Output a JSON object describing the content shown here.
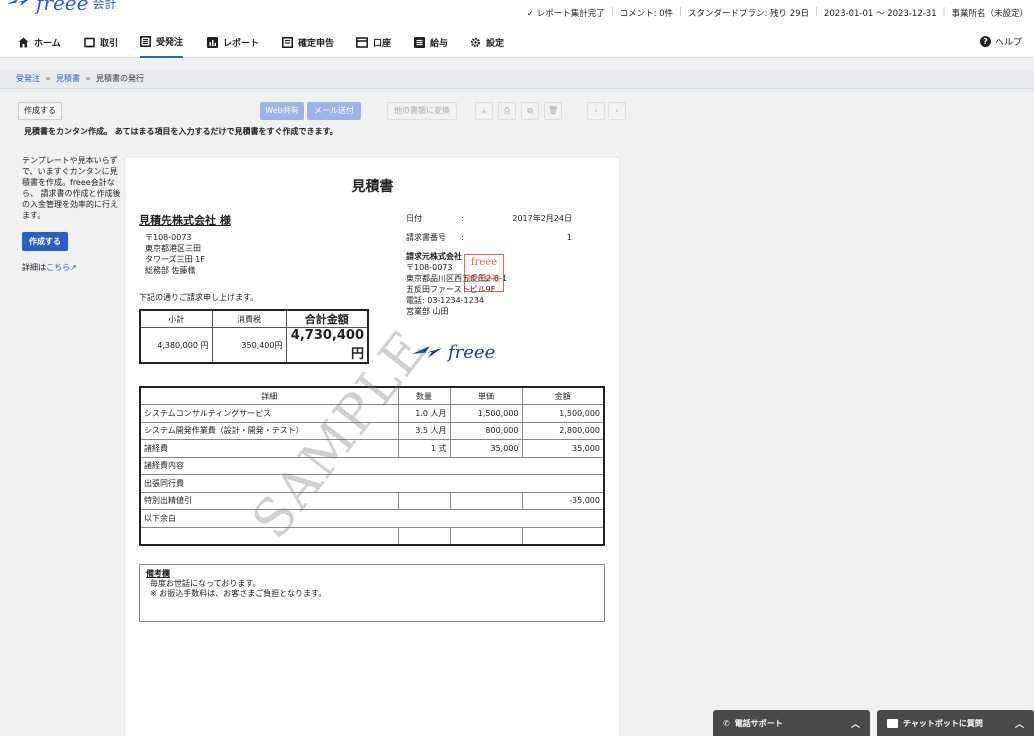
{
  "app": {
    "logo": "freee",
    "logo_sub": "会計"
  },
  "status_bar": {
    "report": "✓ レポート集計完了",
    "comment": "コメント: 0件",
    "plan": "スタンダードプラン: 残り 29日",
    "period": "2023-01-01 〜 2023-12-31",
    "office": "事業所名（未設定）"
  },
  "nav": {
    "items": [
      {
        "label": "ホーム",
        "icon": "home-icon"
      },
      {
        "label": "取引",
        "icon": "transaction-icon"
      },
      {
        "label": "受発注",
        "icon": "order-icon"
      },
      {
        "label": "レポート",
        "icon": "report-icon"
      },
      {
        "label": "確定申告",
        "icon": "tax-return-icon"
      },
      {
        "label": "口座",
        "icon": "account-icon"
      },
      {
        "label": "給与",
        "icon": "payroll-icon"
      },
      {
        "label": "設定",
        "icon": "gear-icon"
      }
    ],
    "active": "受発注",
    "help": "ヘルプ"
  },
  "breadcrumb": {
    "items": [
      "受発注",
      "見積書",
      "見積書の発行"
    ],
    "sep": "»"
  },
  "toolbar": {
    "create": "作成する",
    "web_share": "Web共有",
    "mail_send": "メール送付",
    "convert": "他の書類に変換",
    "download_icon": "⤓",
    "print_icon": "⎙",
    "copy_icon": "⧉",
    "delete_icon": "🗑",
    "prev": "‹",
    "next": "›",
    "description": "見積書をカンタン作成。 あてはまる項目を入力するだけで見積書をすぐ作成できます。"
  },
  "sidebar": {
    "text": "テンプレートや見本いらずで、いますぐカンタンに見積書を作成。freee会計なら、 請求書の作成と作成後の入金管理を効率的に行えます。",
    "create": "作成する",
    "more_prefix": "詳細は",
    "more_link": "こちら"
  },
  "document": {
    "title": "見積書",
    "recipient": "見積先株式会社 様",
    "recipient_address": [
      "〒108-0073",
      "東京都港区三田",
      "タワーズ三田 1F",
      "総務部 佐藤様"
    ],
    "lead": "下記の通りご請求申し上げます。",
    "summary": {
      "headers": [
        "小計",
        "消費税",
        "合計金額"
      ],
      "values": [
        "4,380,000 円",
        "350,400円",
        "4,730,400円"
      ]
    },
    "meta": [
      {
        "key": "日付",
        "value": "2017年2月24日"
      },
      {
        "key": "請求書番号",
        "value": "1"
      }
    ],
    "issuer": {
      "name": "請求元株式会社",
      "lines": [
        "〒108-0073",
        "東京都品川区西五反田2-8-1",
        "五反田ファーストビル9F",
        "電話: 03-1234-1234",
        "営業部 山田"
      ]
    },
    "stamp": [
      "freee",
      "株式会社"
    ],
    "signature": "freee",
    "detail": {
      "headers": [
        "詳細",
        "数量",
        "単価",
        "金額"
      ],
      "rows": [
        [
          "システムコンサルティングサービス",
          "1.0 人月",
          "1,500,000",
          "1,500,000"
        ],
        [
          "システム開発作業費（設計・開発・テスト）",
          "3.5 人月",
          "800,000",
          "2,800,000"
        ],
        [
          "諸経費",
          "1 式",
          "35,000",
          "35,000"
        ],
        [
          "諸経費内容",
          "",
          "",
          ""
        ],
        [
          "出張同行費",
          "",
          "",
          ""
        ],
        [
          "特別出精値引",
          "",
          "",
          "-35,000"
        ],
        [
          "以下余白",
          "",
          "",
          ""
        ],
        [
          "",
          "",
          "",
          ""
        ]
      ]
    },
    "remarks": {
      "heading": "備考欄",
      "lines": [
        "毎度お世話になっております。",
        "※ お振込手数料は、お客さまご負担となります。"
      ]
    },
    "watermark": "SAMPLE"
  },
  "support": {
    "phone": "電話サポート",
    "chatbot": "チャットボットに質問"
  },
  "colors": {
    "accent": "#2d5ec6",
    "stamp": "#e14b3b",
    "support_bar": "#4a4a4a"
  }
}
